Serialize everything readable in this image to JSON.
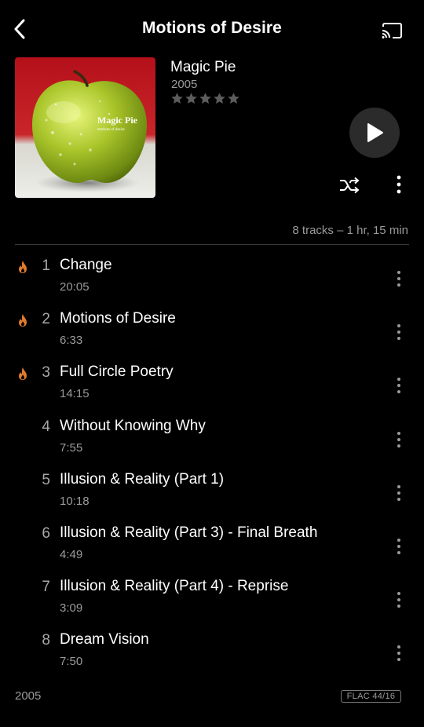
{
  "header": {
    "title": "Motions of Desire",
    "back_icon": "chevron-left-icon",
    "cast_icon": "cast-icon"
  },
  "album": {
    "artist": "Magic Pie",
    "year": "2005",
    "rating": 0,
    "rating_max": 5,
    "cover_text_band": "Magic Pie",
    "cover_text_album": "motions of desire"
  },
  "actions": {
    "play_icon": "play-icon",
    "shuffle_icon": "shuffle-icon",
    "more_icon": "more-vertical-icon"
  },
  "summary": "8 tracks – 1 hr, 15 min",
  "tracks": [
    {
      "number": "1",
      "title": "Change",
      "duration": "20:05",
      "popular": true
    },
    {
      "number": "2",
      "title": "Motions of Desire",
      "duration": "6:33",
      "popular": true
    },
    {
      "number": "3",
      "title": "Full Circle Poetry",
      "duration": "14:15",
      "popular": true
    },
    {
      "number": "4",
      "title": "Without Knowing Why",
      "duration": "7:55",
      "popular": false
    },
    {
      "number": "5",
      "title": "Illusion & Reality (Part 1)",
      "duration": "10:18",
      "popular": false
    },
    {
      "number": "6",
      "title": "Illusion & Reality (Part 3) - Final Breath",
      "duration": "4:49",
      "popular": false
    },
    {
      "number": "7",
      "title": "Illusion & Reality (Part 4) - Reprise",
      "duration": "3:09",
      "popular": false
    },
    {
      "number": "8",
      "title": "Dream Vision",
      "duration": "7:50",
      "popular": false
    }
  ],
  "footer": {
    "year": "2005",
    "format": "FLAC 44/16"
  },
  "colors": {
    "background": "#000000",
    "accent_flame": "#e07a2c",
    "secondary_text": "#9a9a9a",
    "play_button_bg": "#2b2b2b"
  }
}
